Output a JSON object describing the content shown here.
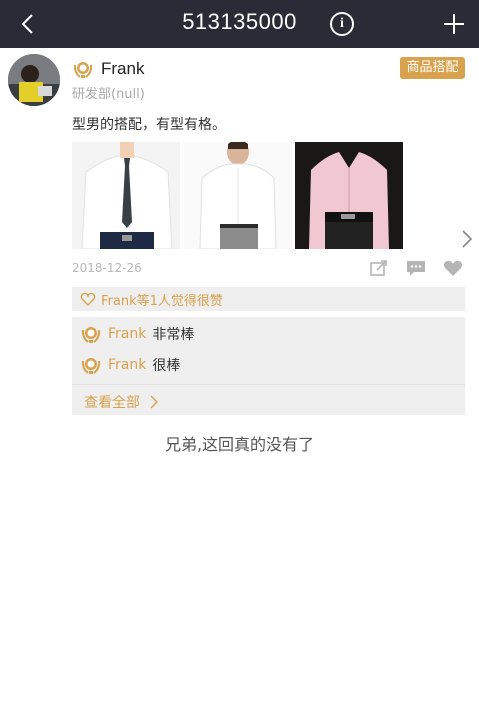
{
  "header": {
    "title": "513135000"
  },
  "post": {
    "author": "Frank",
    "department": "研发部(null)",
    "tag": "商品搭配",
    "text": "型男的搭配，有型有格。",
    "date": "2018-12-26",
    "likes_summary": "Frank等1人觉得很赞"
  },
  "comments": [
    {
      "author": "Frank",
      "text": "非常棒"
    },
    {
      "author": "Frank",
      "text": "很棒"
    }
  ],
  "view_all_label": "查看全部",
  "end_text": "兄弟,这回真的没有了",
  "colors": {
    "header_bg": "#2a2b37",
    "accent": "#d9a24e",
    "panel_bg": "#efefef"
  }
}
